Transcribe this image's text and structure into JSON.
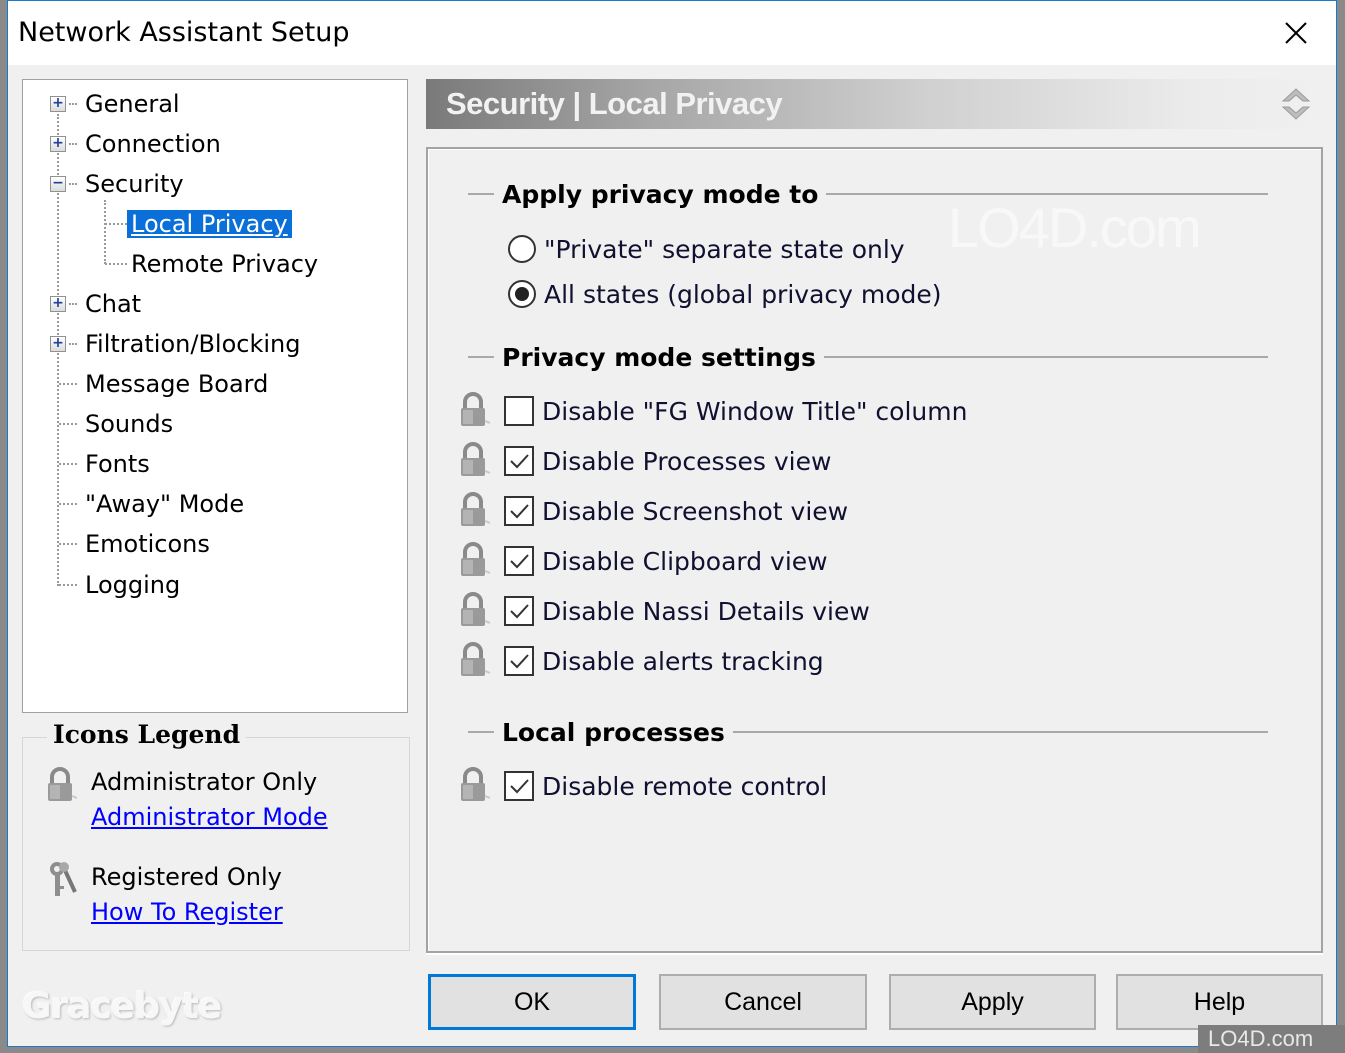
{
  "window": {
    "title": "Network Assistant Setup",
    "close_icon": "close-icon"
  },
  "tree": {
    "items": [
      {
        "label": "General",
        "level": 0,
        "expander": "+",
        "selected": false
      },
      {
        "label": "Connection",
        "level": 0,
        "expander": "+",
        "selected": false
      },
      {
        "label": "Security",
        "level": 0,
        "expander": "-",
        "selected": false
      },
      {
        "label": "Local Privacy",
        "level": 1,
        "expander": null,
        "selected": true
      },
      {
        "label": "Remote Privacy",
        "level": 1,
        "expander": null,
        "selected": false
      },
      {
        "label": "Chat",
        "level": 0,
        "expander": "+",
        "selected": false
      },
      {
        "label": "Filtration/Blocking",
        "level": 0,
        "expander": "+",
        "selected": false
      },
      {
        "label": "Message Board",
        "level": 0,
        "expander": null,
        "selected": false
      },
      {
        "label": "Sounds",
        "level": 0,
        "expander": null,
        "selected": false
      },
      {
        "label": "Fonts",
        "level": 0,
        "expander": null,
        "selected": false
      },
      {
        "label": "\"Away\" Mode",
        "level": 0,
        "expander": null,
        "selected": false
      },
      {
        "label": "Emoticons",
        "level": 0,
        "expander": null,
        "selected": false
      },
      {
        "label": "Logging",
        "level": 0,
        "expander": null,
        "selected": false
      }
    ]
  },
  "legend": {
    "title": "Icons Legend",
    "admin_label": "Administrator Only",
    "admin_link": "Administrator Mode",
    "registered_label": "Registered Only",
    "registered_link": "How To Register",
    "admin_icon": "lock-icon",
    "registered_icon": "keys-icon"
  },
  "brand": "Gracebyte",
  "banner": {
    "title": "Security | Local Privacy",
    "arrows_icon": "collapse-arrows-icon"
  },
  "groups": {
    "apply_privacy": {
      "title": "Apply privacy mode to",
      "options": [
        {
          "label": "\"Private\" separate state only",
          "checked": false
        },
        {
          "label": "All states (global privacy mode)",
          "checked": true
        }
      ]
    },
    "privacy_settings": {
      "title": "Privacy mode settings",
      "options": [
        {
          "label": "Disable \"FG Window Title\" column",
          "checked": false,
          "admin_only": true
        },
        {
          "label": "Disable Processes view",
          "checked": true,
          "admin_only": true
        },
        {
          "label": "Disable Screenshot view",
          "checked": true,
          "admin_only": true
        },
        {
          "label": "Disable Clipboard view",
          "checked": true,
          "admin_only": true
        },
        {
          "label": "Disable Nassi Details view",
          "checked": true,
          "admin_only": true
        },
        {
          "label": "Disable alerts tracking",
          "checked": true,
          "admin_only": true
        }
      ]
    },
    "local_processes": {
      "title": "Local processes",
      "options": [
        {
          "label": "Disable remote control",
          "checked": true,
          "admin_only": true
        }
      ]
    }
  },
  "buttons": {
    "ok": "OK",
    "cancel": "Cancel",
    "apply": "Apply",
    "help": "Help"
  },
  "watermarks": {
    "main": "LO4D.com",
    "corner": "LO4D.com"
  }
}
